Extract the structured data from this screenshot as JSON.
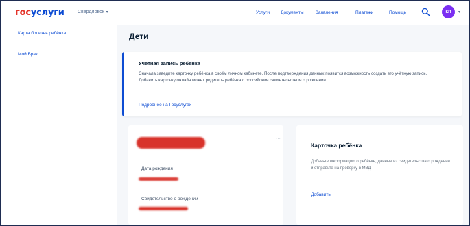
{
  "header": {
    "logo_gos": "гос",
    "logo_uslugi": "услуги",
    "region": "Свердловск",
    "nav": [
      "Услуги",
      "Документы",
      "Заявления",
      "Платежи",
      "Помощь"
    ],
    "avatar_initials": "КП"
  },
  "sidebar": {
    "items": [
      "Карта болезнь ребёнка",
      "Мой Брак"
    ]
  },
  "main": {
    "title": "Дети",
    "info_card": {
      "title": "Учётная запись ребёнка",
      "text": "Сначала заведите карточку ребёнка в своём личном кабинете. После подтверждения данных появится возможность создать его учётную запись. Добавить карточку онлайн может родитель ребёнка с российским свидетельством о рождении",
      "link": "Подробнее на Госуслугах"
    },
    "child_card": {
      "menu_icon": "···",
      "birth_date_label": "Дата рождения",
      "certificate_label": "Свидетельство о рождении"
    },
    "add_card": {
      "title": "Карточка ребёнка",
      "text": "Добавьте информацию о ребёнке, данные из свидетельства о рождении и отправьте на проверку в МВД",
      "link": "Добавить"
    }
  },
  "colors": {
    "brand_blue": "#0d4cd3",
    "brand_red": "#e4342a",
    "redaction_red": "#d8332b",
    "avatar_purple": "#7b2ff2"
  }
}
